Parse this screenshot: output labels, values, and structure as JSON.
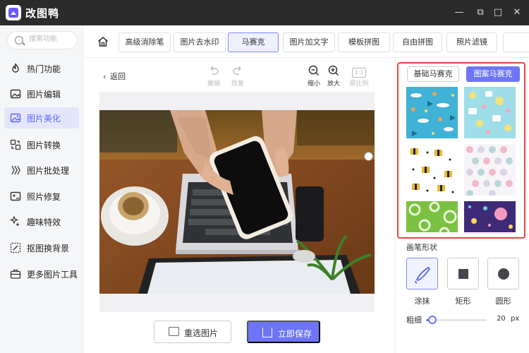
{
  "app": {
    "title": "改图鸭"
  },
  "window": {
    "minimize": "—",
    "maximize": "□",
    "close": "✕",
    "restore": "⧉"
  },
  "search": {
    "placeholder": "搜索功能"
  },
  "sidebar": {
    "items": [
      {
        "label": "热门功能",
        "icon": "fire-icon",
        "active": false
      },
      {
        "label": "图片编辑",
        "icon": "image-edit-icon",
        "active": false
      },
      {
        "label": "图片美化",
        "icon": "image-beautify-icon",
        "active": true
      },
      {
        "label": "图片转换",
        "icon": "convert-icon",
        "active": false
      },
      {
        "label": "图片批处理",
        "icon": "batch-icon",
        "active": false
      },
      {
        "label": "照片修复",
        "icon": "repair-icon",
        "active": false
      },
      {
        "label": "趣味特效",
        "icon": "sparkle-icon",
        "active": false
      },
      {
        "label": "抠图换背景",
        "icon": "cutout-icon",
        "active": false
      },
      {
        "label": "更多图片工具",
        "icon": "toolbox-icon",
        "active": false
      }
    ]
  },
  "tabs": [
    {
      "label": "高级消除笔",
      "active": false
    },
    {
      "label": "图片去水印",
      "active": false
    },
    {
      "label": "马赛克",
      "active": true
    },
    {
      "label": "图片加文字",
      "active": false
    },
    {
      "label": "模板拼图",
      "active": false
    },
    {
      "label": "自由拼图",
      "active": false
    },
    {
      "label": "照片滤镜",
      "active": false
    }
  ],
  "editor": {
    "back": "返回",
    "undo": "撤销",
    "redo": "恢复",
    "zoom_out": "缩小",
    "zoom_in": "放大",
    "ratio": "1:1",
    "original_ratio": "原比例",
    "reselect": "重选图片",
    "save": "立即保存"
  },
  "panel": {
    "basic_mosaic": "基础马赛克",
    "pattern_mosaic": "图案马赛克",
    "patterns": [
      "ocean-fish-pattern",
      "baby-items-pattern",
      "gift-stars-pattern",
      "pastel-dots-pattern",
      "green-rings-pattern",
      "purple-confetti-pattern"
    ],
    "selected_pattern": null,
    "brush_shape_title": "画笔形状",
    "shapes": [
      {
        "label": "涂抹",
        "icon": "brush-icon",
        "active": true
      },
      {
        "label": "矩形",
        "icon": "square-icon",
        "active": false
      },
      {
        "label": "圆形",
        "icon": "circle-icon",
        "active": false
      }
    ],
    "brush_size_label": "粗细",
    "brush_size": 20,
    "brush_size_max": 200,
    "brush_size_unit": "px"
  },
  "colors": {
    "accent": "#6d75f6",
    "highlight_frame": "#e2483d",
    "titlebar": "#2b2b2b"
  }
}
